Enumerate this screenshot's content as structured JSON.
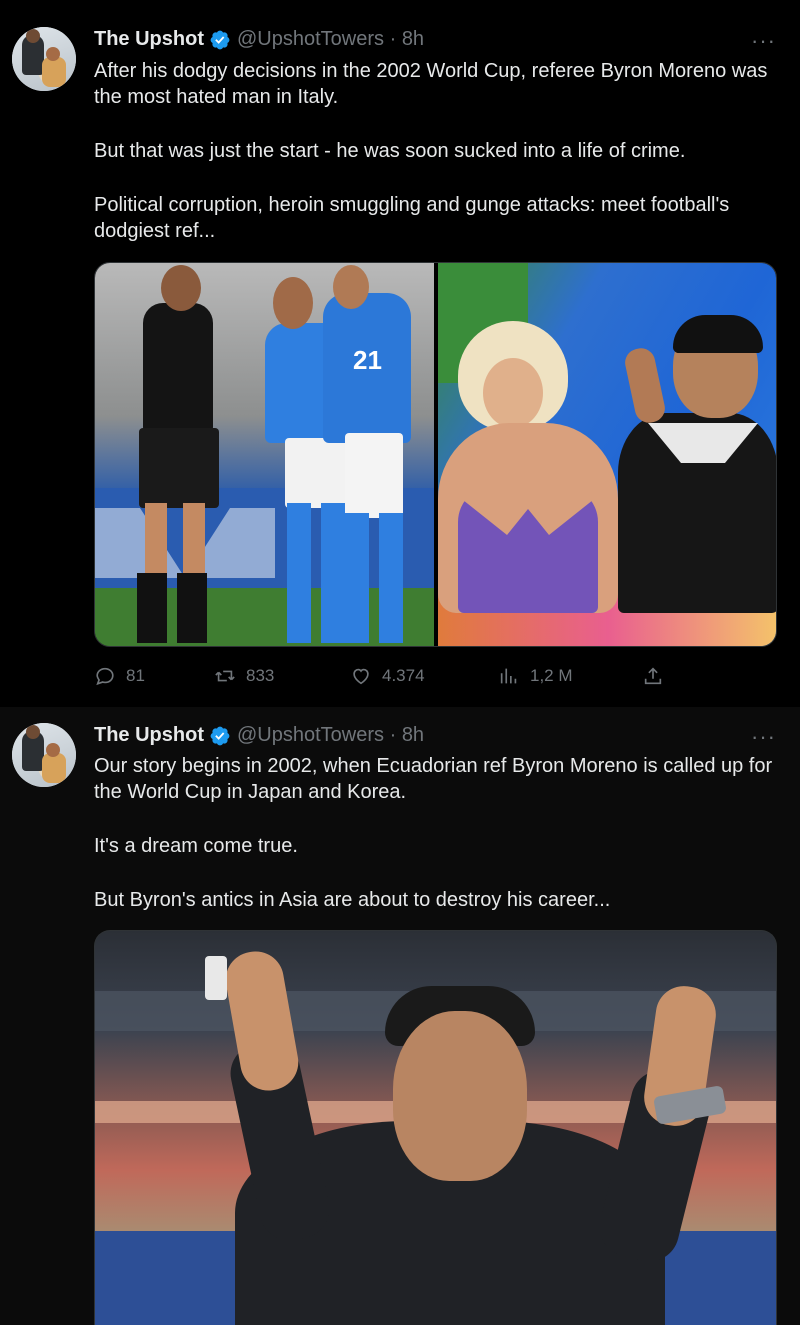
{
  "tweets": [
    {
      "author": "The Upshot",
      "handle": "@UpshotTowers",
      "time": "8h",
      "more": "···",
      "paragraphs": [
        "After his dodgy decisions in the 2002 World Cup, referee Byron Moreno was the most hated man in Italy.",
        "But that was just the start - he was soon sucked into a life of crime.",
        "Political corruption, heroin smuggling and gunge attacks: meet football's dodgiest ref..."
      ],
      "shirt_number": "21",
      "stats": {
        "replies": "81",
        "reposts": "833",
        "likes": "4.374",
        "views": "1,2 M"
      }
    },
    {
      "author": "The Upshot",
      "handle": "@UpshotTowers",
      "time": "8h",
      "more": "···",
      "paragraphs": [
        "Our story begins in 2002, when Ecuadorian ref Byron Moreno is called up for the World Cup in Japan and Korea.",
        "It's a dream come true.",
        "But Byron's antics in Asia are about to destroy his career..."
      ]
    }
  ],
  "colors": {
    "background": "#000000",
    "text": "#e7e9ea",
    "muted": "#71767b",
    "verified": "#1d9bf0"
  },
  "icons": [
    "verified-badge-icon",
    "more-icon",
    "reply-icon",
    "repost-icon",
    "like-icon",
    "views-icon",
    "share-icon"
  ]
}
